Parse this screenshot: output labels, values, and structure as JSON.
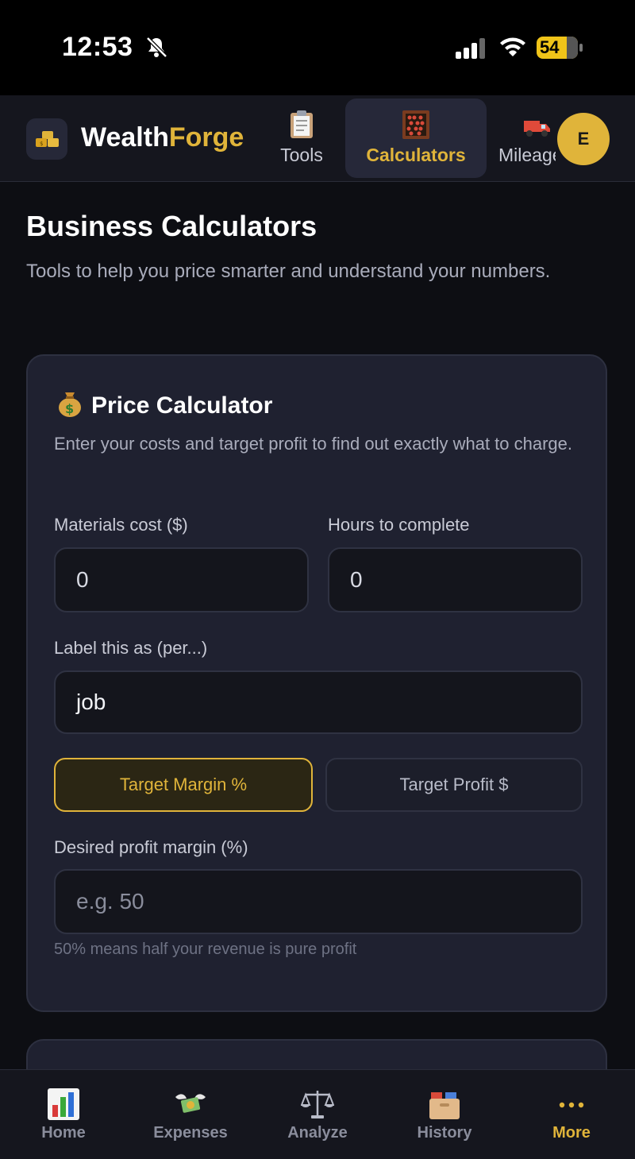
{
  "status_bar": {
    "time": "12:53",
    "battery": "54"
  },
  "header": {
    "brand_part1": "Wealth",
    "brand_part2": "Forge",
    "tabs": [
      {
        "label": "Tools",
        "icon": "clipboard-icon"
      },
      {
        "label": "Calculators",
        "icon": "abacus-icon",
        "active": true
      },
      {
        "label": "Mileage",
        "icon": "truck-icon"
      }
    ],
    "avatar_initial": "E"
  },
  "page": {
    "title": "Business Calculators",
    "subtitle": "Tools to help you price smarter and understand your numbers."
  },
  "price_calculator": {
    "icon": "money-bag-icon",
    "title": "Price Calculator",
    "description": "Enter your costs and target profit to find out exactly what to charge.",
    "materials_label": "Materials cost ($)",
    "materials_value": "0",
    "hours_label": "Hours to complete",
    "hours_value": "0",
    "label_field_label": "Label this as (per...)",
    "label_field_value": "job",
    "mode_margin": "Target Margin %",
    "mode_profit": "Target Profit $",
    "margin_label": "Desired profit margin (%)",
    "margin_placeholder": "e.g. 50",
    "margin_hint": "50% means half your revenue is pure profit"
  },
  "bottom_nav": {
    "items": [
      {
        "label": "Home",
        "icon": "bar-chart-icon"
      },
      {
        "label": "Expenses",
        "icon": "money-wings-icon"
      },
      {
        "label": "Analyze",
        "icon": "scales-icon"
      },
      {
        "label": "History",
        "icon": "card-box-icon"
      },
      {
        "label": "More",
        "icon": "more-dots-icon",
        "active": true
      }
    ]
  },
  "colors": {
    "accent": "#e0b43a",
    "background": "#0d0e13",
    "card": "#1f2130"
  }
}
